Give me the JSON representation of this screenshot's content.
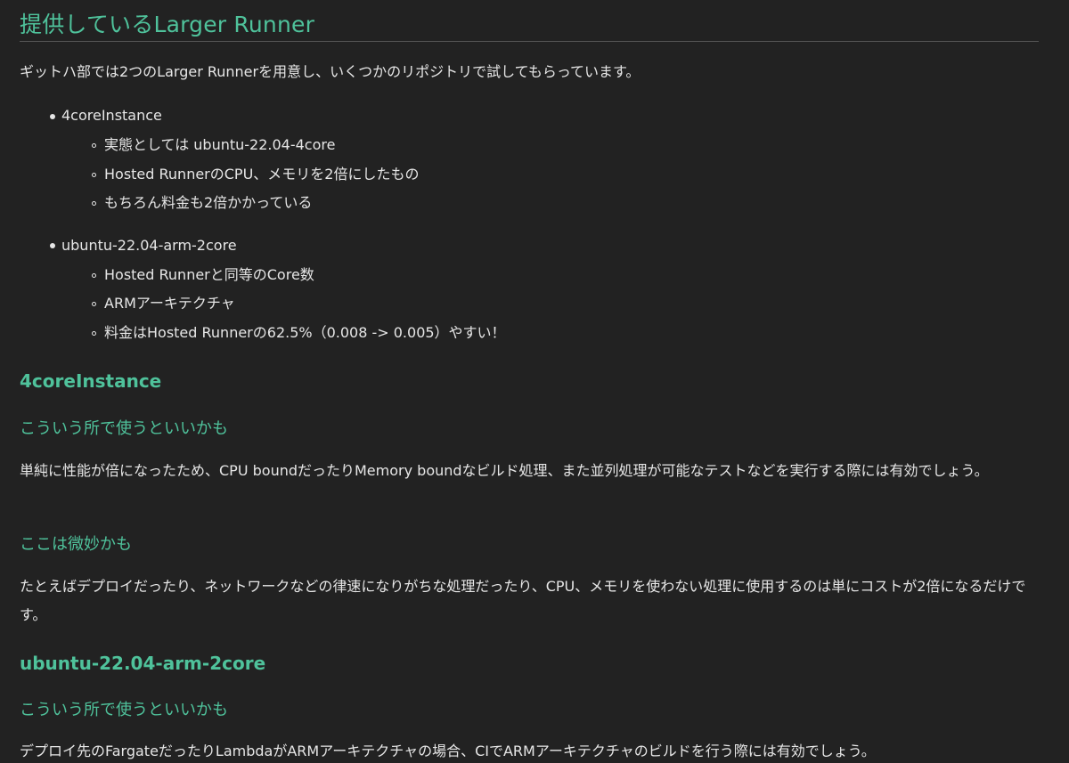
{
  "title": "提供しているLarger Runner",
  "intro": "ギットハ部では2つのLarger Runnerを用意し、いくつかのリポジトリで試してもらっています。",
  "list": [
    {
      "label": "4coreInstance",
      "sub": [
        "実態としては ubuntu-22.04-4core",
        "Hosted RunnerのCPU、メモリを2倍にしたもの",
        "もちろん料金も2倍かかっている"
      ]
    },
    {
      "label": "ubuntu-22.04-arm-2core",
      "sub": [
        "Hosted Runnerと同等のCore数",
        "ARMアーキテクチャ",
        "料金はHosted Runnerの62.5%（0.008 -> 0.005）やすい！"
      ]
    }
  ],
  "sections": [
    {
      "heading": "4coreInstance",
      "good_heading": "こういう所で使うといいかも",
      "good_text": "単純に性能が倍になったため、CPU boundだったりMemory boundなビルド処理、また並列処理が可能なテストなどを実行する際には有効でしょう。",
      "bad_heading": "ここは微妙かも",
      "bad_text": "たとえばデプロイだったり、ネットワークなどの律速になりがちな処理だったり、CPU、メモリを使わない処理に使用するのは単にコストが2倍になるだけです。"
    },
    {
      "heading": "ubuntu-22.04-arm-2core",
      "good_heading": "こういう所で使うといいかも",
      "good_text": "デプロイ先のFargateだったりLambdaがARMアーキテクチャの場合、CIでARMアーキテクチャのビルドを行う際には有効でしょう。"
    }
  ],
  "colors": {
    "background": "#222222",
    "accent": "#4fc29b",
    "text": "#e6e6e6",
    "rule": "#555555"
  }
}
